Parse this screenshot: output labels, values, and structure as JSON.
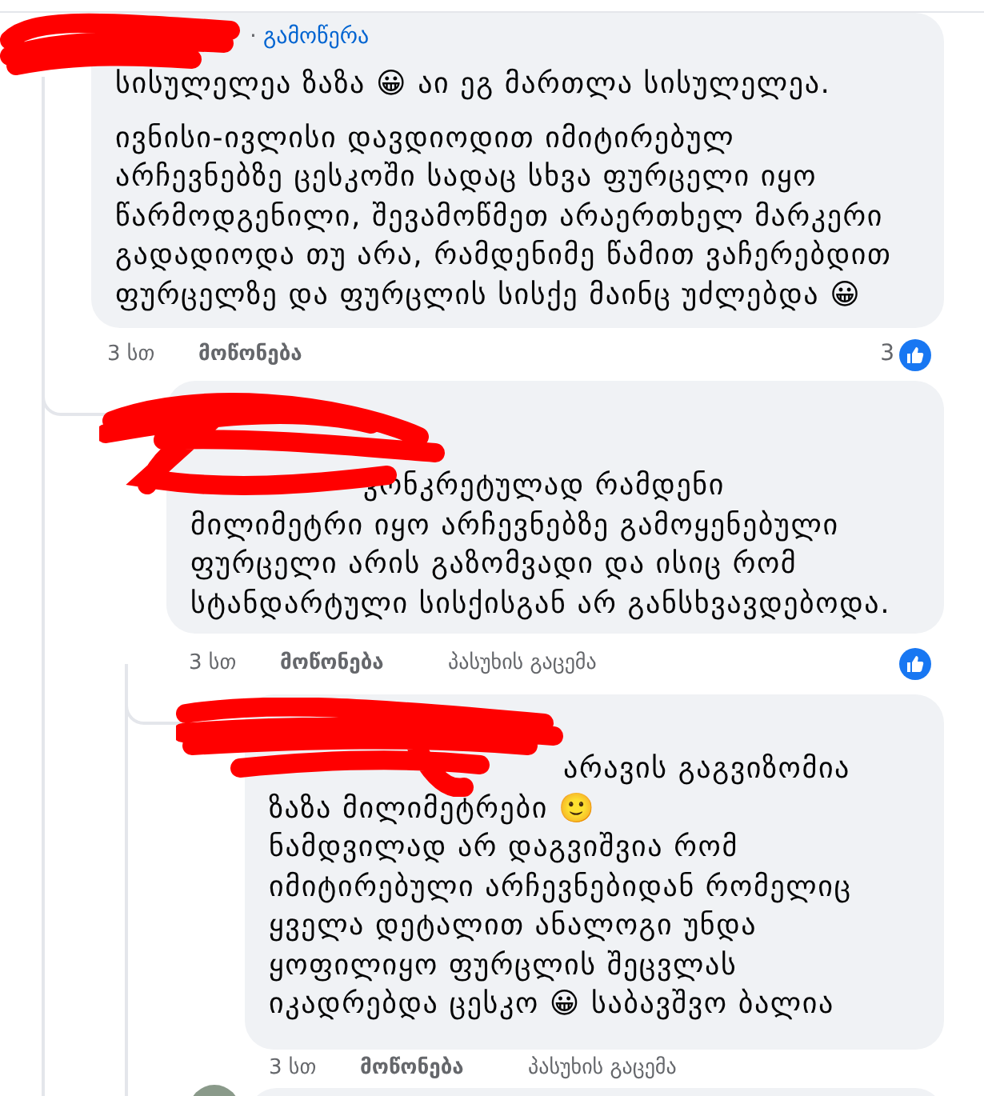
{
  "comments": [
    {
      "redacted": true,
      "subscribe": {
        "separator": "·",
        "label": "გამოწერა"
      },
      "paragraphs": [
        [
          "სისულელეა ზაზა 😀 აი ეგ მართლა სისულელეა."
        ],
        [
          "ივნისი-ივლისი დავდიოდით იმიტირებულ",
          "არჩევნებზე ცესკოში სადაც სხვა ფურცელი იყო",
          "წარმოდგენილი, შევამოწმეთ არაერთხელ მარკერი",
          "გადადიოდა თუ არა, რამდენიმე წამით ვაჩერებდით",
          "ფურცელზე და ფურცლის სისქე მაინც უძლებდა 😀"
        ]
      ],
      "time": "3 სთ",
      "like_label": "მოწონება",
      "reaction_icon": true,
      "reaction_count": "3",
      "replies": [
        {
          "redacted": true,
          "paragraphs": [
            [
              "კონკრეტულად რამდენი",
              "მილიმეტრი იყო არჩევნებზე გამოყენებული",
              "ფურცელი არის გაზომვადი და ისიც რომ",
              "სტანდარტული სისქისგან არ განსხვავდებოდა."
            ]
          ],
          "time": "3 სთ",
          "like_label": "მოწონება",
          "reply_label": "პასუხის გაცემა",
          "reaction_icon": true,
          "replies": [
            {
              "redacted": true,
              "paragraphs": [
                [
                  "არავის გაგვიზომია",
                  "ზაზა მილიმეტრები 🙂",
                  "ნამდვილად არ დაგვიშვია რომ",
                  "იმიტირებული არჩევნებიდან რომელიც",
                  "ყველა დეტალით ანალოგი უნდა",
                  "ყოფილიყო ფურცლის შეცვლას",
                  "იკადრებდა ცესკო 😀 საბავშვო ბალია"
                ]
              ],
              "time": "3 სთ",
              "like_label": "მოწონება",
              "reply_label": "პასუხის გაცემა",
              "reaction_icon": false
            }
          ]
        }
      ]
    }
  ]
}
